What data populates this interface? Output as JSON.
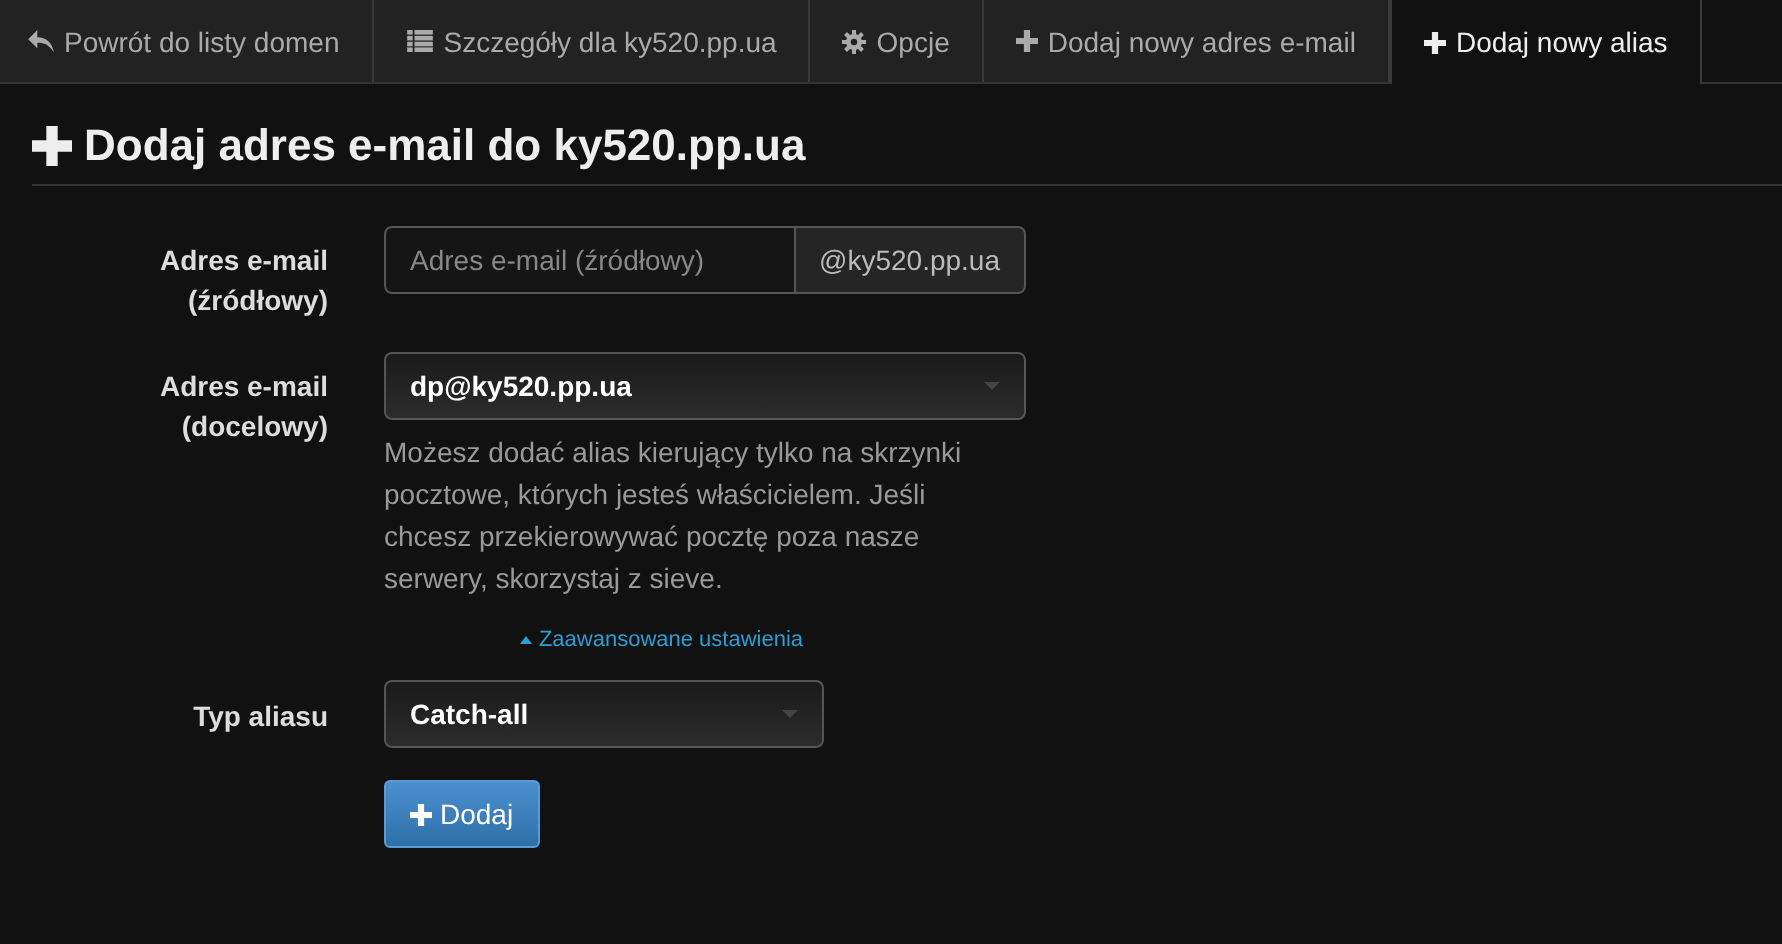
{
  "tabs": [
    {
      "label": "Powrót do listy domen",
      "kind": "back",
      "selected": false
    },
    {
      "label": "Szczegóły dla ky520.pp.ua",
      "kind": "details",
      "selected": false
    },
    {
      "label": "Opcje",
      "kind": "options",
      "selected": false
    },
    {
      "label": "Dodaj nowy adres e-mail",
      "kind": "add",
      "selected": false
    },
    {
      "label": "Dodaj nowy alias",
      "kind": "add",
      "selected": true
    }
  ],
  "heading": "Dodaj adres e-mail do ky520.pp.ua",
  "form": {
    "source": {
      "label": "Adres e-mail (źródłowy)",
      "placeholder": "Adres e-mail (źródłowy)",
      "addon": "@ky520.pp.ua"
    },
    "target": {
      "label": "Adres e-mail (docelowy)",
      "value": "dp@ky520.pp.ua",
      "help": "Możesz dodać alias kierujący tylko na skrzynki pocztowe, których jesteś właścicielem. Jeśli chcesz przekierowywać pocztę poza nasze serwery, skorzystaj z sieve."
    },
    "advanced_link": {
      "label": "Zaawansowane ustawienia",
      "expanded": true
    },
    "alias_type": {
      "label": "Typ aliasu",
      "value": "Catch-all"
    },
    "submit": {
      "label": "Dodaj"
    }
  }
}
